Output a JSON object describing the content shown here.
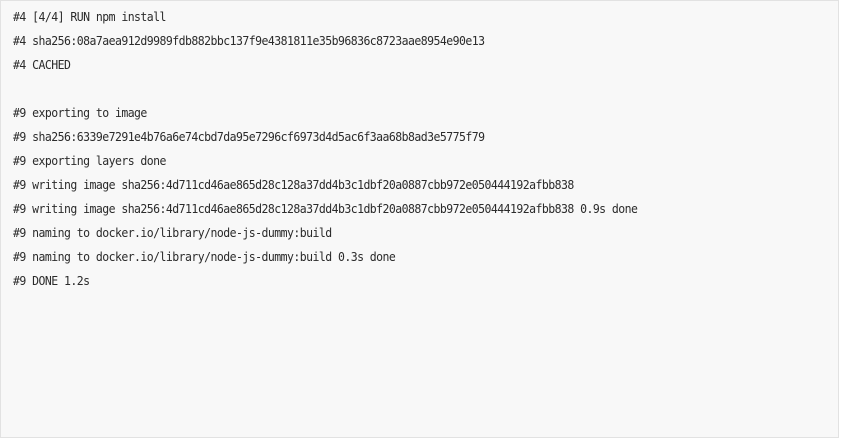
{
  "log": {
    "lines": [
      "#4 [4/4] RUN npm install",
      "#4 sha256:08a7aea912d9989fdb882bbc137f9e4381811e35b96836c8723aae8954e90e13",
      "#4 CACHED",
      "",
      "#9 exporting to image",
      "#9 sha256:6339e7291e4b76a6e74cbd7da95e7296cf6973d4d5ac6f3aa68b8ad3e5775f79",
      "#9 exporting layers done",
      "#9 writing image sha256:4d711cd46ae865d28c128a37dd4b3c1dbf20a0887cbb972e050444192afbb838",
      "#9 writing image sha256:4d711cd46ae865d28c128a37dd4b3c1dbf20a0887cbb972e050444192afbb838 0.9s done",
      "#9 naming to docker.io/library/node-js-dummy:build",
      "#9 naming to docker.io/library/node-js-dummy:build 0.3s done",
      "#9 DONE 1.2s"
    ]
  }
}
